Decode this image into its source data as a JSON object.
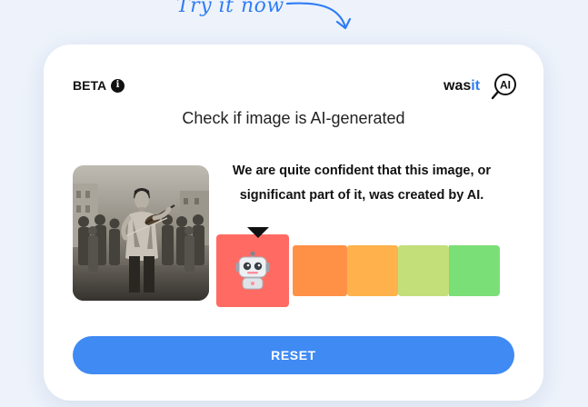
{
  "banner": {
    "caption": "Try it now",
    "arrow_icon": "curved-arrow-icon"
  },
  "card": {
    "beta_label": "BETA",
    "info_icon": "info-icon",
    "info_glyph": "i",
    "logo": {
      "text_part": "was",
      "accent_part": "it",
      "circle_text": "AI",
      "icon": "magnifier-logo-icon"
    },
    "title": "Check if image is AI-generated",
    "image": {
      "icon": "uploaded-photo-thumbnail"
    },
    "verdict": "We are quite confident that this image, or significant part of it, was created by AI.",
    "scale": {
      "active_index": 0,
      "active_icon": "robot-icon",
      "pointer_icon": "caret-down-icon",
      "segments": [
        {
          "color": "#ff6b63"
        },
        {
          "color": "#ff9147"
        },
        {
          "color": "#ffb24c"
        },
        {
          "color": "#c3df79"
        },
        {
          "color": "#7bdf78"
        }
      ]
    },
    "reset_label": "RESET"
  },
  "colors": {
    "accent": "#3f8af3",
    "caption": "#2f7df5",
    "logo_accent": "#2f7df5",
    "background": "#eef3fb"
  }
}
